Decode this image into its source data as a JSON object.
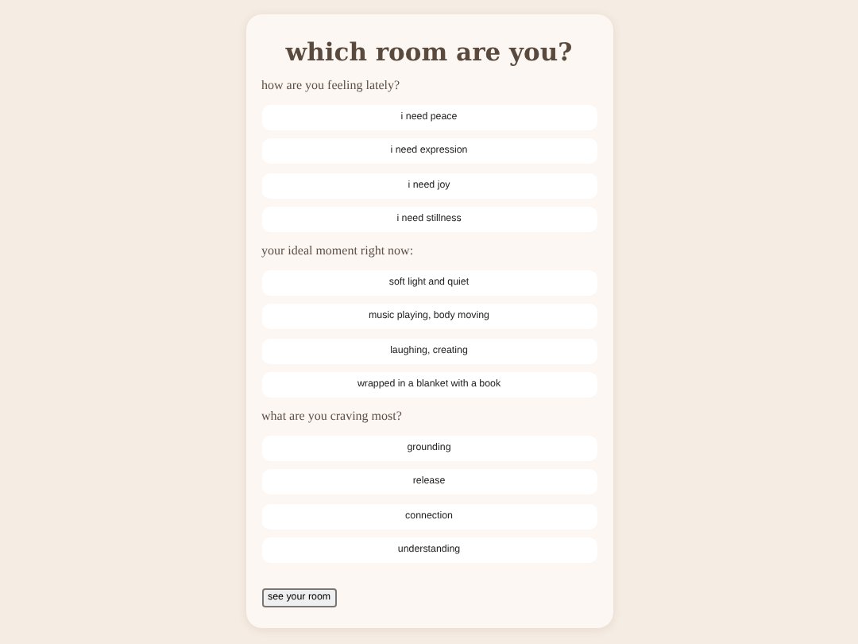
{
  "title": "which room are you?",
  "questions": [
    {
      "prompt": "how are you feeling lately?",
      "options": [
        "i need peace",
        "i need expression",
        "i need joy",
        "i need stillness"
      ]
    },
    {
      "prompt": "your ideal moment right now:",
      "options": [
        "soft light and quiet",
        "music playing, body moving",
        "laughing, creating",
        "wrapped in a blanket with a book"
      ]
    },
    {
      "prompt": "what are you craving most?",
      "options": [
        "grounding",
        "release",
        "connection",
        "understanding"
      ]
    }
  ],
  "submit": "see your room"
}
